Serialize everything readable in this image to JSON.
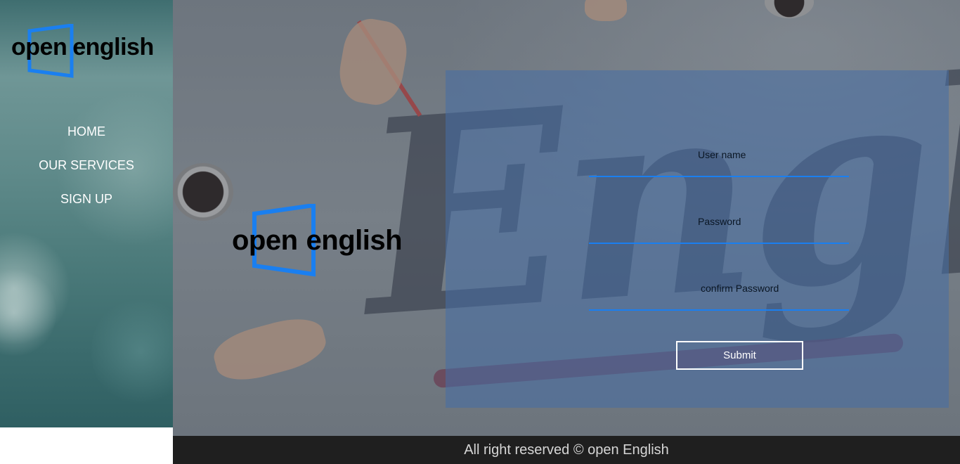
{
  "brand": {
    "logo_word1": "open",
    "logo_word2": "english",
    "frame_color": "#1a7ff0"
  },
  "sidebar": {
    "items": [
      {
        "label": "HOME"
      },
      {
        "label": "OUR SERVICES"
      },
      {
        "label": "SIGN UP"
      }
    ]
  },
  "form": {
    "username_label": "User name",
    "password_label": "Password",
    "confirm_label": "confirm Password",
    "submit_label": "Submit"
  },
  "footer": {
    "text": "All right reserved © open English"
  },
  "colors": {
    "accent": "#1a7ff0",
    "footer_bg": "#1f1f1f",
    "panel": "rgba(70,110,165,0.55)"
  }
}
